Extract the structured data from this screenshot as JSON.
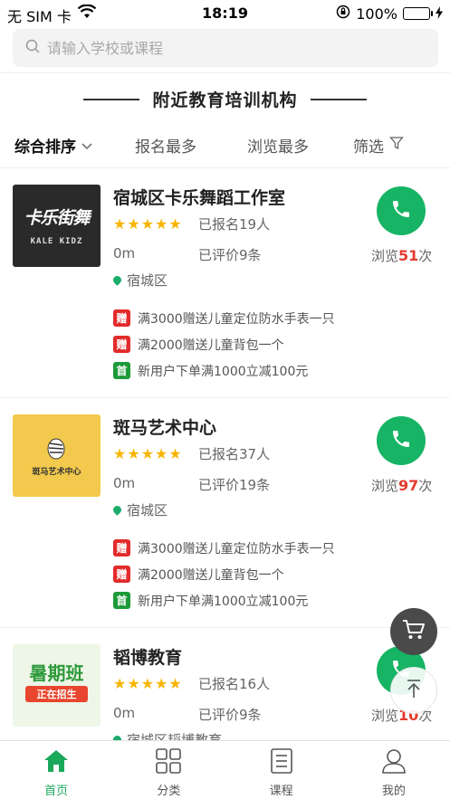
{
  "status_bar": {
    "carrier": "无 SIM 卡",
    "time": "18:19",
    "battery": "100%"
  },
  "search": {
    "placeholder": "请输入学校或课程"
  },
  "section_title": "附近教育培训机构",
  "sort_bar": {
    "sort_label": "综合排序",
    "most_enrolled": "报名最多",
    "most_viewed": "浏览最多",
    "filter": "筛选"
  },
  "cards": [
    {
      "name": "宿城区卡乐舞蹈工作室",
      "enrolled": "已报名19人",
      "distance": "0m",
      "reviews": "已评价9条",
      "district": "宿城区",
      "views_prefix": "浏览",
      "views_count": "51",
      "views_suffix": "次",
      "rating": 5,
      "logo_text": "卡乐街舞",
      "logo_sub": "KALE KIDZ",
      "promos": [
        {
          "tag": "赠",
          "color": "red",
          "text": "满3000赠送儿童定位防水手表一只"
        },
        {
          "tag": "赠",
          "color": "red",
          "text": "满2000赠送儿童背包一个"
        },
        {
          "tag": "首",
          "color": "green",
          "text": "新用户下单满1000立减100元"
        }
      ]
    },
    {
      "name": "斑马艺术中心",
      "enrolled": "已报名37人",
      "distance": "0m",
      "reviews": "已评价19条",
      "district": "宿城区",
      "views_prefix": "浏览",
      "views_count": "97",
      "views_suffix": "次",
      "rating": 5,
      "logo_text": "斑马艺术中心",
      "promos": [
        {
          "tag": "赠",
          "color": "red",
          "text": "满3000赠送儿童定位防水手表一只"
        },
        {
          "tag": "赠",
          "color": "red",
          "text": "满2000赠送儿童背包一个"
        },
        {
          "tag": "首",
          "color": "green",
          "text": "新用户下单满1000立减100元"
        }
      ]
    },
    {
      "name": "韬博教育",
      "enrolled": "已报名16人",
      "distance": "0m",
      "reviews": "已评价9条",
      "district": "宿城区韬博教育",
      "views_prefix": "浏览",
      "views_count": "10",
      "views_suffix": "次",
      "rating": 5,
      "logo_text": "暑期班",
      "logo_sub": "正在招生"
    }
  ],
  "tabbar": [
    {
      "label": "首页",
      "icon": "home-icon"
    },
    {
      "label": "分类",
      "icon": "grid-icon"
    },
    {
      "label": "课程",
      "icon": "list-icon"
    },
    {
      "label": "我的",
      "icon": "user-icon"
    }
  ],
  "colors": {
    "accent": "#16b464",
    "price": "#e33b2e",
    "star": "#f7b500"
  }
}
